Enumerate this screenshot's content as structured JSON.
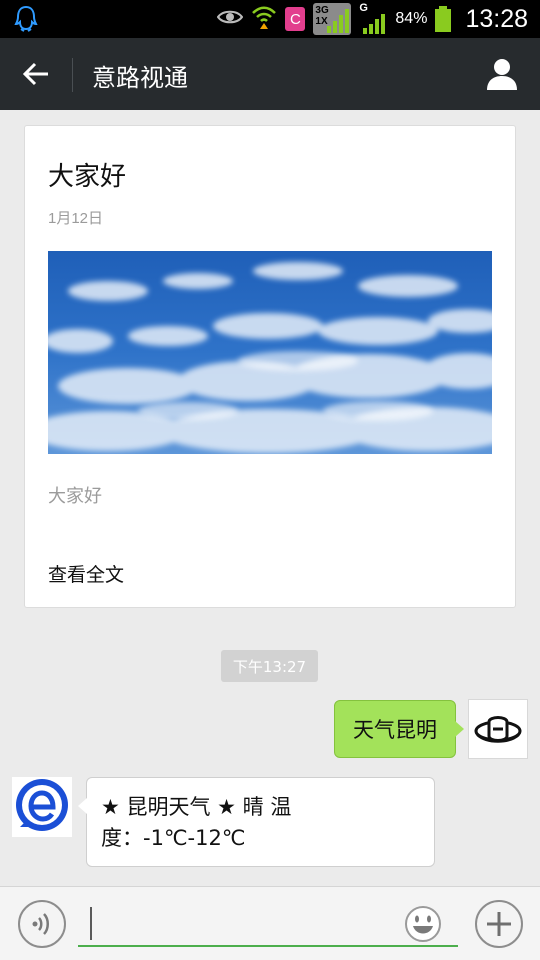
{
  "status_bar": {
    "time": "13:28",
    "battery_percent": "84%",
    "network_3g": "3G",
    "network_1x": "1X",
    "network_g": "G",
    "app_badge": "C",
    "icons": [
      "qq-penguin-icon",
      "eye-icon",
      "wifi-icon",
      "app-c-icon",
      "signal-3g-icon",
      "signal-g-icon",
      "battery-icon"
    ],
    "battery_color": "#8acb1f"
  },
  "header": {
    "title": "意路视通",
    "back_icon": "back-arrow-icon",
    "profile_icon": "person-icon"
  },
  "article_card": {
    "title": "大家好",
    "date": "1月12日",
    "image": "blue-sky-clouds",
    "summary": "大家好",
    "read_more": "查看全文"
  },
  "timestamp": "下午13:27",
  "messages": [
    {
      "from": "me",
      "text": "天气昆明",
      "avatar": "brand-logo-avatar"
    },
    {
      "from": "account",
      "text": "★ 昆明天气 ★ 晴 温度：-1℃-12℃",
      "avatar": "blue-e-avatar"
    }
  ],
  "input_bar": {
    "value": "",
    "voice_icon": "voice-icon",
    "emoji_icon": "smiley-icon",
    "plus_icon": "plus-icon"
  },
  "colors": {
    "title_bar": "#272b2e",
    "chat_bg": "#ebebeb",
    "my_bubble": "#a3e25a",
    "input_underline": "#4cae4c"
  }
}
